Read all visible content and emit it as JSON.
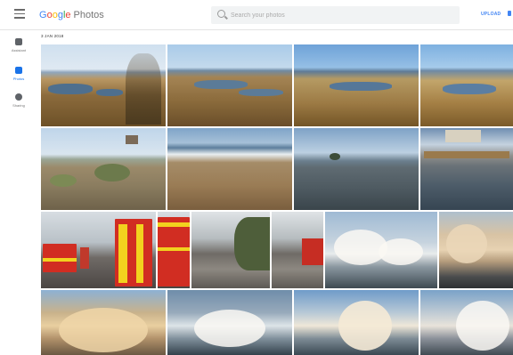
{
  "header": {
    "logo_google": "Google",
    "logo_product": "Photos",
    "search_placeholder": "Search your photos",
    "upload_label": "UPLOAD"
  },
  "sidebar": {
    "items": [
      {
        "label": "Assistant",
        "icon": "assistant-icon",
        "active": false
      },
      {
        "label": "Photos",
        "icon": "photos-icon",
        "active": true
      },
      {
        "label": "Sharing",
        "icon": "sharing-icon",
        "active": false
      }
    ]
  },
  "gallery": {
    "date": "3 JAN 2018"
  },
  "colors": {
    "accent": "#1a73e8",
    "google_blue": "#4285f4",
    "google_red": "#ea4335",
    "google_yellow": "#fbbc05",
    "google_green": "#34a853"
  }
}
